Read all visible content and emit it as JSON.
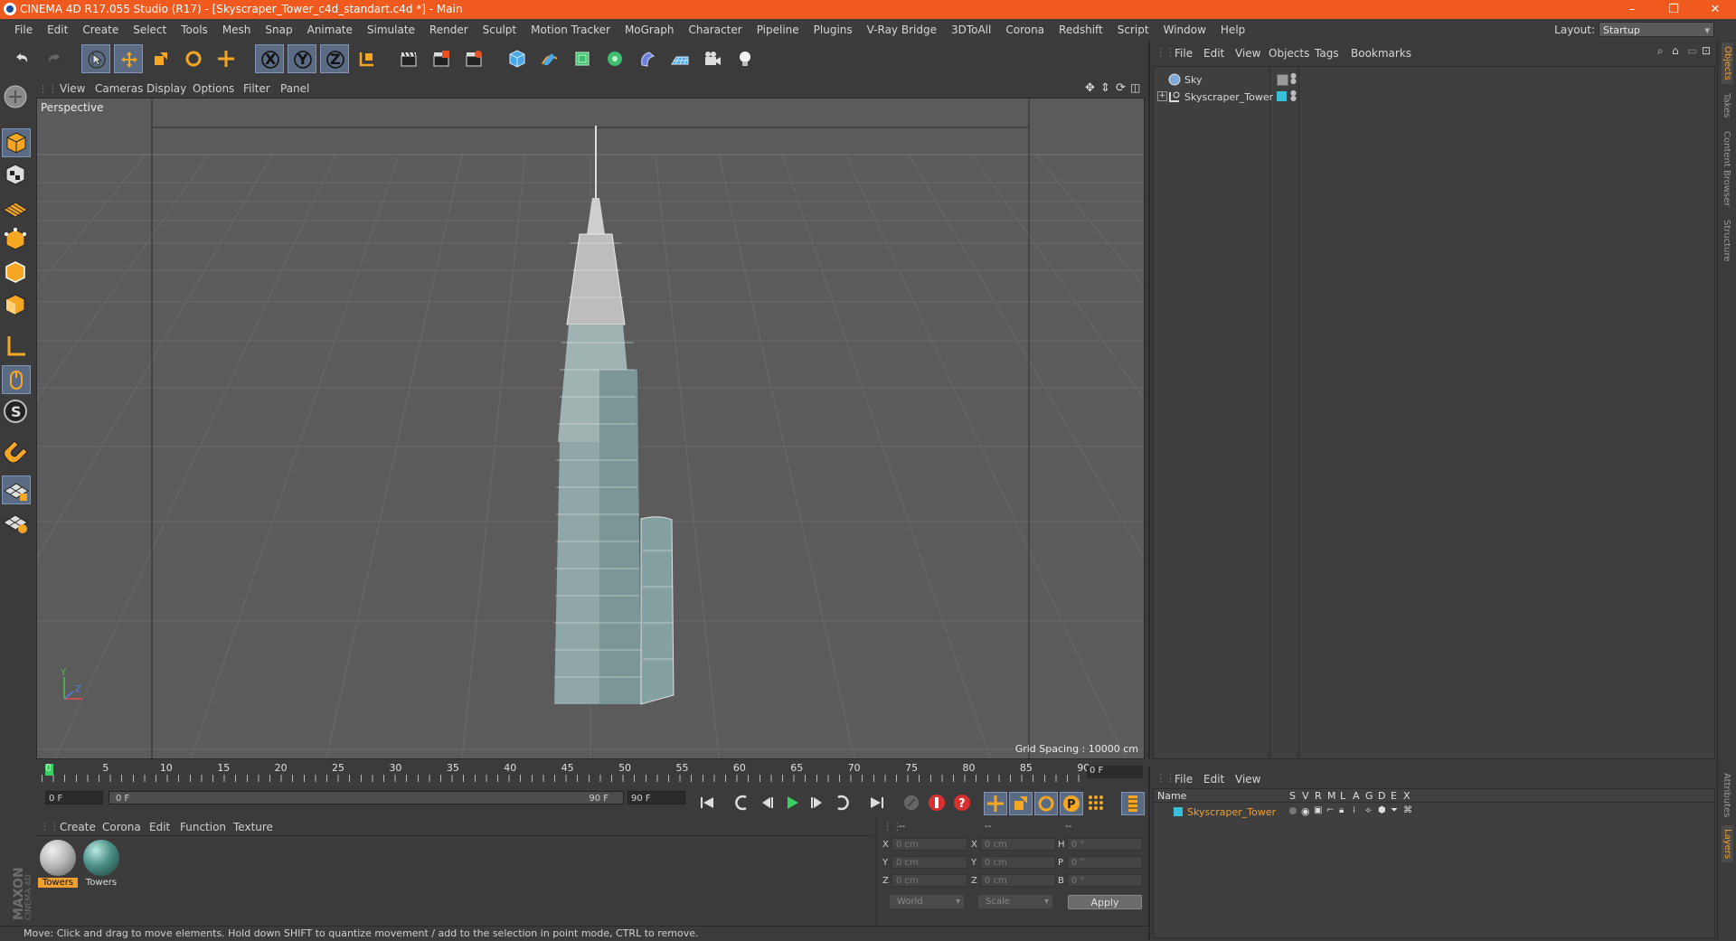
{
  "window": {
    "title": "CINEMA 4D R17.055 Studio (R17) - [Skyscraper_Tower_c4d_standart.c4d *] - Main",
    "controls": [
      "–",
      "❐",
      "✕"
    ]
  },
  "menubar": {
    "items": [
      "File",
      "Edit",
      "Create",
      "Select",
      "Tools",
      "Mesh",
      "Snap",
      "Animate",
      "Simulate",
      "Render",
      "Sculpt",
      "Motion Tracker",
      "MoGraph",
      "Character",
      "Pipeline",
      "Plugins",
      "V-Ray Bridge",
      "3DToAll",
      "Corona",
      "Redshift",
      "Script",
      "Window",
      "Help"
    ],
    "layout_label": "Layout:",
    "layout_value": "Startup"
  },
  "toolbar": {
    "axis_labels": [
      "X",
      "Y",
      "Z"
    ]
  },
  "viewport": {
    "menu": [
      "View",
      "Cameras",
      "Display",
      "Options",
      "Filter",
      "Panel"
    ],
    "camera_label": "Perspective",
    "grid_spacing": "Grid Spacing : 10000 cm"
  },
  "timeline": {
    "ticks": [
      "0",
      "5",
      "10",
      "15",
      "20",
      "25",
      "30",
      "35",
      "40",
      "45",
      "50",
      "55",
      "60",
      "65",
      "70",
      "75",
      "80",
      "85",
      "90"
    ],
    "current_frame": "0 F",
    "start_field": "0 F",
    "range_start": "0 F",
    "range_end": "90 F",
    "end_field": "90 F"
  },
  "materials": {
    "menu": [
      "Create",
      "Corona",
      "Edit",
      "Function",
      "Texture"
    ],
    "items": [
      {
        "label": "Towers",
        "color": "#b8b8b8",
        "selected": true
      },
      {
        "label": "Towers",
        "color": "#4a8f86",
        "selected": false
      }
    ]
  },
  "coordinates": {
    "header": [
      "--",
      "--",
      "--"
    ],
    "rows": [
      {
        "pos_label": "X",
        "pos": "0 cm",
        "size_label": "X",
        "size": "0 cm",
        "rot_label": "H",
        "rot": "0 °"
      },
      {
        "pos_label": "Y",
        "pos": "0 cm",
        "size_label": "Y",
        "size": "0 cm",
        "rot_label": "P",
        "rot": "0 °"
      },
      {
        "pos_label": "Z",
        "pos": "0 cm",
        "size_label": "Z",
        "size": "0 cm",
        "rot_label": "B",
        "rot": "0 °"
      }
    ],
    "mode": "World",
    "size_mode": "Scale",
    "apply": "Apply"
  },
  "objects": {
    "menu": [
      "File",
      "Edit",
      "View",
      "Objects",
      "Tags",
      "Bookmarks"
    ],
    "items": [
      {
        "name": "Sky",
        "tag_color": "#9b9b9b"
      },
      {
        "name": "Skyscraper_Tower",
        "tag_color": "#37c0d8"
      }
    ]
  },
  "layers": {
    "menu": [
      "File",
      "Edit",
      "View"
    ],
    "columns": [
      "Name",
      "S",
      "V",
      "R",
      "M",
      "L",
      "A",
      "G",
      "D",
      "E",
      "X"
    ],
    "items": [
      {
        "name": "Skyscraper_Tower",
        "color": "#37c0d8"
      }
    ]
  },
  "side_tabs": [
    "Objects",
    "Takes",
    "Content Browser",
    "Structure",
    "Attributes",
    "Layers"
  ],
  "status": "Move: Click and drag to move elements. Hold down SHIFT to quantize movement / add to the selection in point mode, CTRL to remove.",
  "colors": {
    "title_bar": "#f05a1e",
    "panel_bg": "#3b3b3b",
    "viewport_bg": "#5b5b5b",
    "accent_orange": "#f0a030",
    "active_blue": "#5a6b83"
  }
}
